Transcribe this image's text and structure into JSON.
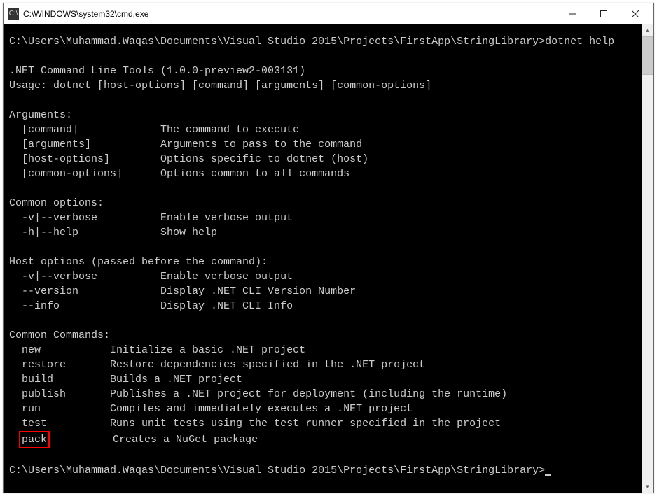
{
  "titlebar": {
    "icon_label": "C:\\",
    "title": "C:\\WINDOWS\\system32\\cmd.exe"
  },
  "terminal": {
    "prompt_line": "C:\\Users\\Muhammad.Waqas\\Documents\\Visual Studio 2015\\Projects\\FirstApp\\StringLibrary>dotnet help",
    "info_line1": ".NET Command Line Tools (1.0.0-preview2-003131)",
    "info_line2": "Usage: dotnet [host-options] [command] [arguments] [common-options]",
    "arguments_heading": "Arguments:",
    "arguments": [
      {
        "name": "  [command]",
        "desc": "The command to execute"
      },
      {
        "name": "  [arguments]",
        "desc": "Arguments to pass to the command"
      },
      {
        "name": "  [host-options]",
        "desc": "Options specific to dotnet (host)"
      },
      {
        "name": "  [common-options]",
        "desc": "Options common to all commands"
      }
    ],
    "common_options_heading": "Common options:",
    "common_options": [
      {
        "name": "  -v|--verbose",
        "desc": "Enable verbose output"
      },
      {
        "name": "  -h|--help",
        "desc": "Show help"
      }
    ],
    "host_options_heading": "Host options (passed before the command):",
    "host_options": [
      {
        "name": "  -v|--verbose",
        "desc": "Enable verbose output"
      },
      {
        "name": "  --version",
        "desc": "Display .NET CLI Version Number"
      },
      {
        "name": "  --info",
        "desc": "Display .NET CLI Info"
      }
    ],
    "commands_heading": "Common Commands:",
    "commands": [
      {
        "name": "  new",
        "desc": "Initialize a basic .NET project"
      },
      {
        "name": "  restore",
        "desc": "Restore dependencies specified in the .NET project"
      },
      {
        "name": "  build",
        "desc": "Builds a .NET project"
      },
      {
        "name": "  publish",
        "desc": "Publishes a .NET project for deployment (including the runtime)"
      },
      {
        "name": "  run",
        "desc": "Compiles and immediately executes a .NET project"
      },
      {
        "name": "  test",
        "desc": "Runs unit tests using the test runner specified in the project"
      }
    ],
    "highlighted_command_name": "pack",
    "highlighted_command_desc": "Creates a NuGet package",
    "prompt_idle": "C:\\Users\\Muhammad.Waqas\\Documents\\Visual Studio 2015\\Projects\\FirstApp\\StringLibrary>"
  },
  "layout": {
    "arg_col_width": 24,
    "cmd_col_width": 16
  }
}
